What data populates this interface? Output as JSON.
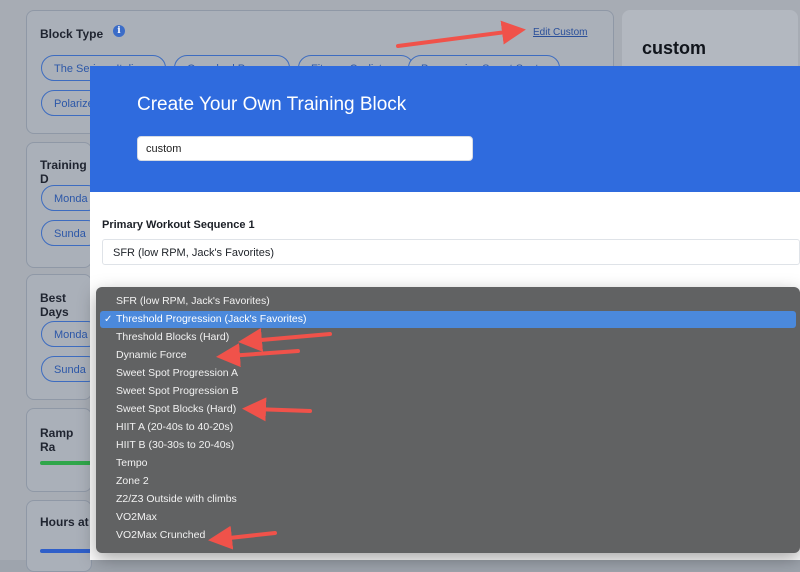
{
  "background": {
    "block_type_label": "Block Type",
    "edit_custom_link": "Edit Custom",
    "block_pills": [
      "The Serious Italian",
      "Overshed Power",
      "Fitness Cyclist",
      "Progressive Sweet Spot",
      "Polarized"
    ],
    "training_days_label": "Training D",
    "training_day_pills": [
      "Monda",
      "Sunda"
    ],
    "best_days_label": "Best Days",
    "best_day_pills": [
      "Monda",
      "Sunda"
    ],
    "ramp_rate_label": "Ramp Ra",
    "hours_label": "Hours at",
    "right_card_title": "custom",
    "colors": {
      "ramp_bar": "#2fa64a",
      "hours_bar": "#2f5fc9"
    }
  },
  "modal": {
    "title": "Create Your Own Training Block",
    "name_value": "custom",
    "primary_sequence_label": "Primary Workout Sequence 1",
    "primary_sequence_value": "SFR (low RPM, Jack's Favorites)",
    "header_color": "#2f6bde"
  },
  "dropdown": {
    "options": [
      "SFR (low RPM, Jack's Favorites)",
      "Threshold Progression (Jack's Favorites)",
      "Threshold Blocks (Hard)",
      "Dynamic Force",
      "Sweet Spot Progression A",
      "Sweet Spot Progression B",
      "Sweet Spot Blocks (Hard)",
      "HIIT A (20-40s to 40-20s)",
      "HIIT B (30-30s to 20-40s)",
      "Tempo",
      "Zone 2",
      "Z2/Z3 Outside with climbs",
      "VO2Max",
      "VO2Max Crunched"
    ],
    "selected_index": 1,
    "check_icon": "checkmark-icon"
  },
  "annotations": {
    "arrow_color": "#f0524a",
    "arrows_point_to": [
      "edit-custom-link",
      "threshold-blocks-option",
      "dynamic-force-option",
      "sweet-spot-blocks-option",
      "vo2max-crunched-option"
    ]
  }
}
